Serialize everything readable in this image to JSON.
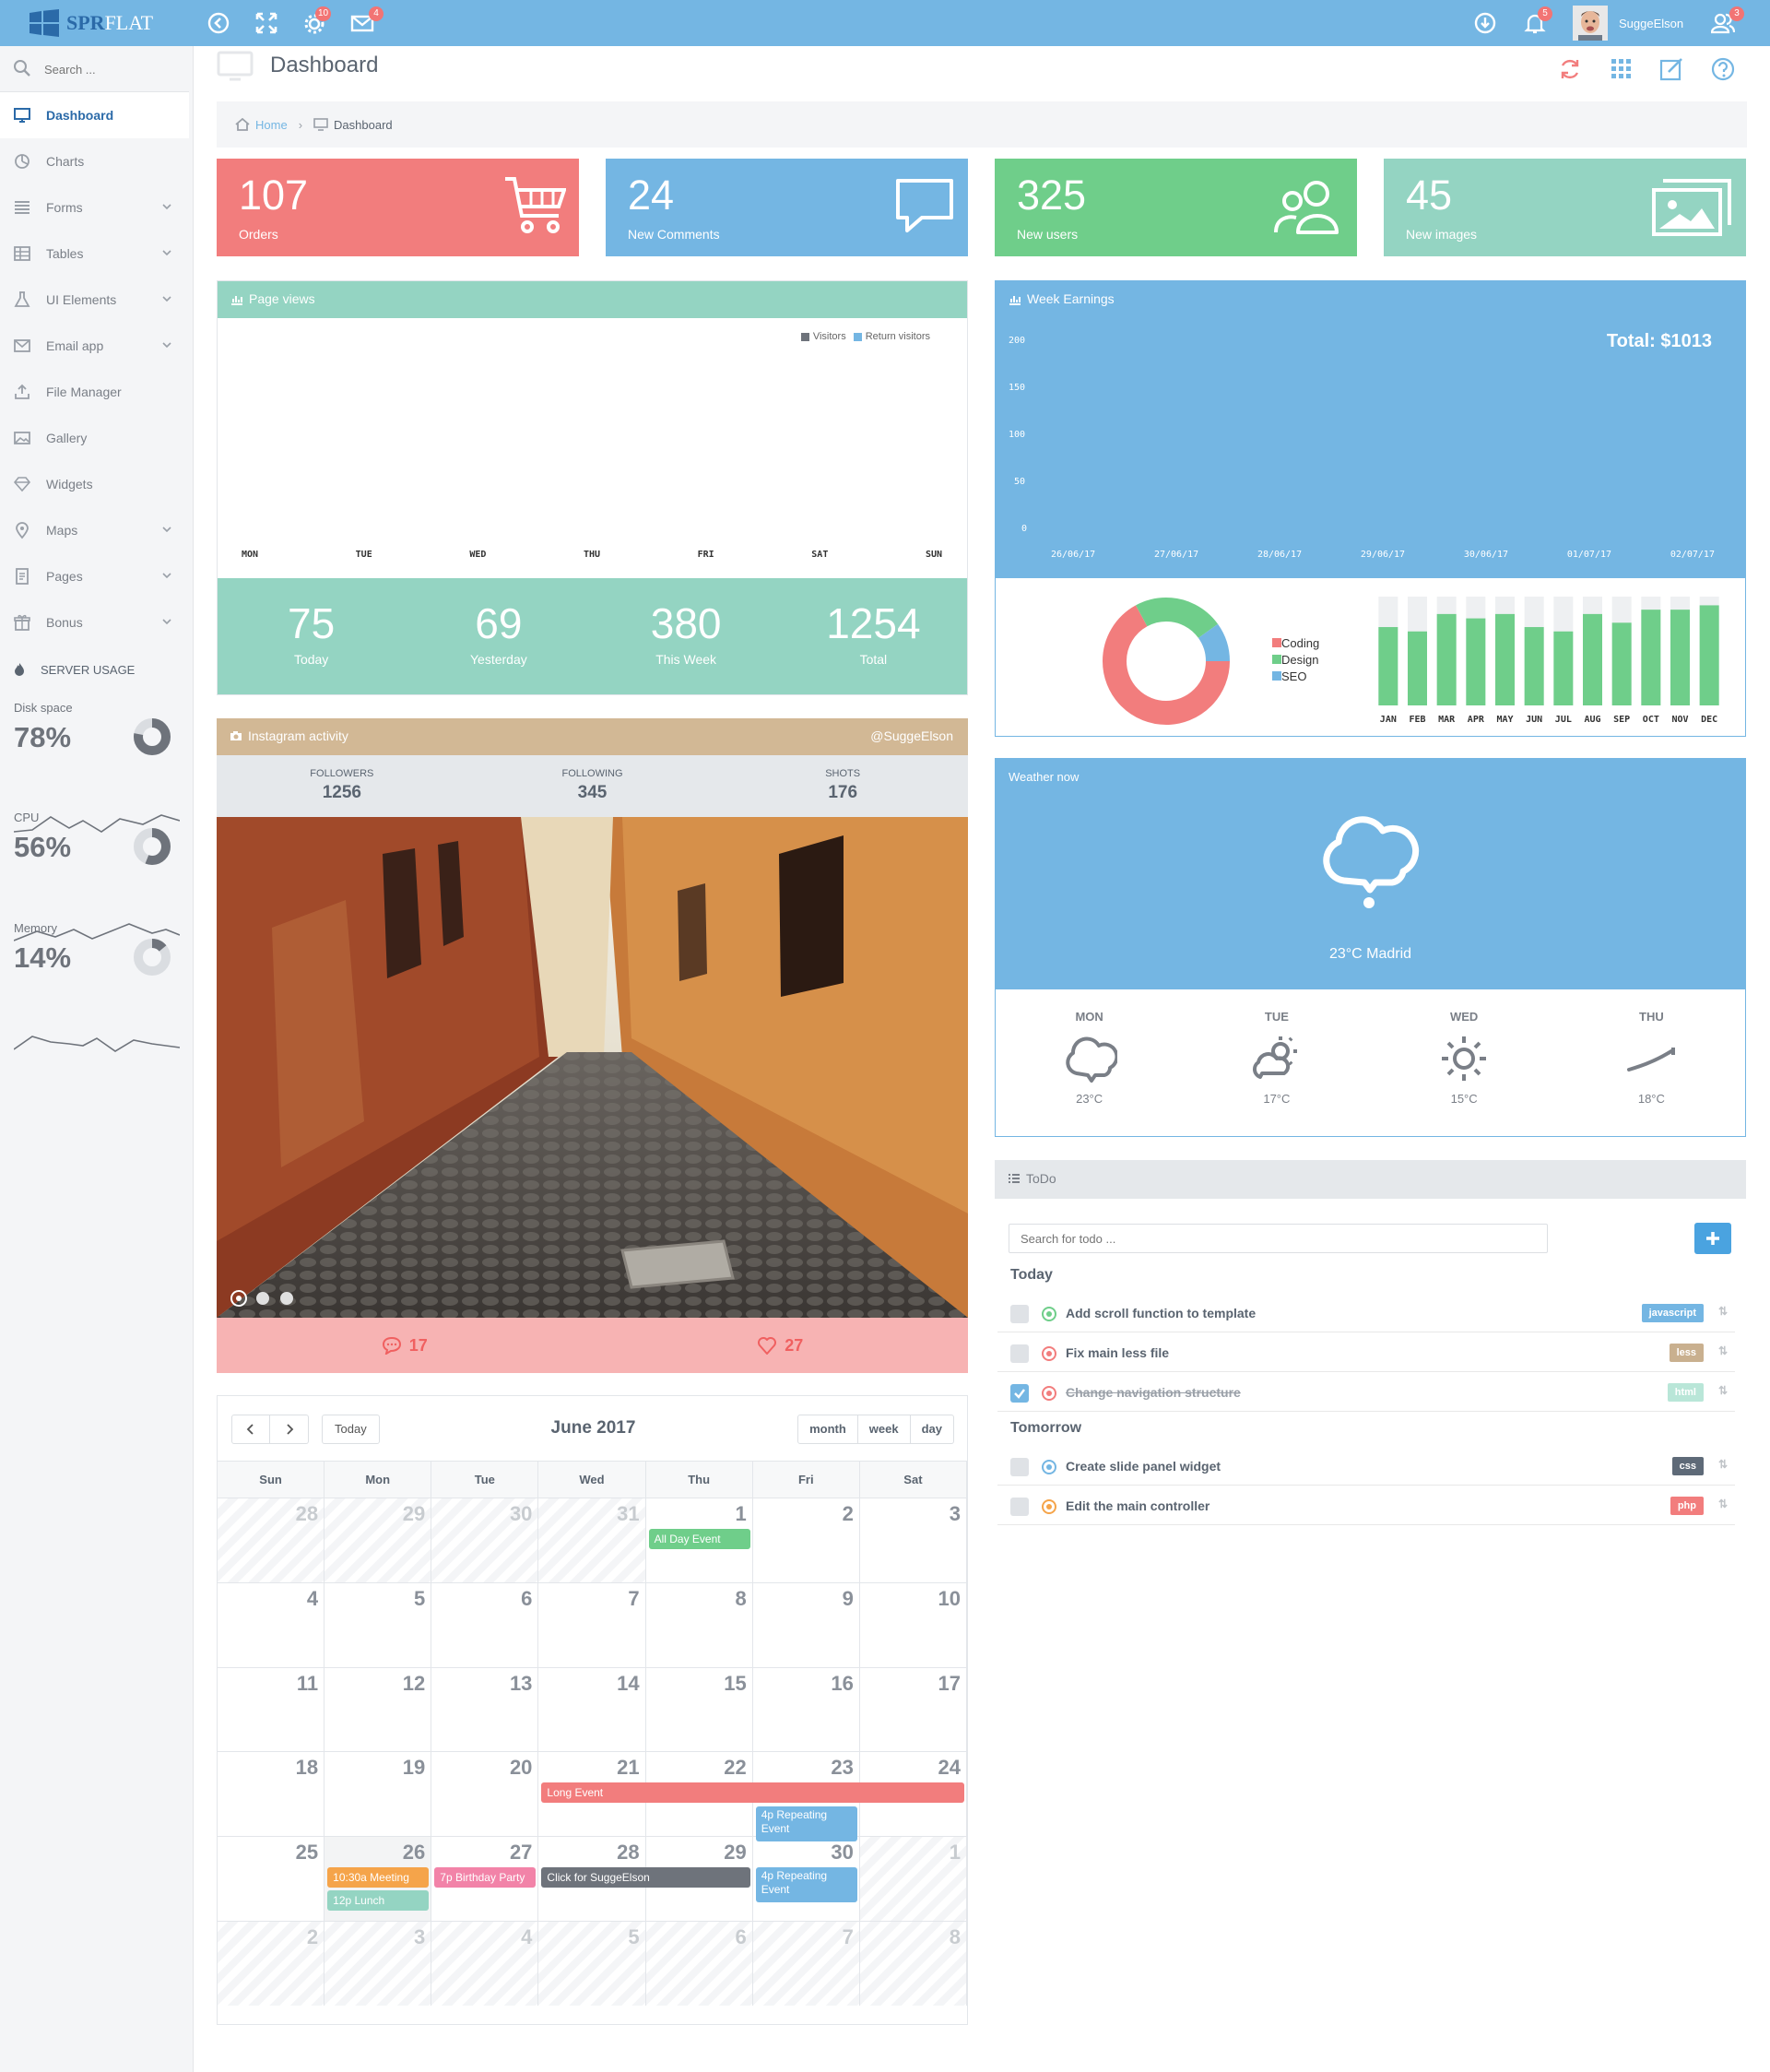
{
  "topbar": {
    "brand_bold": "SPR",
    "brand_light": "FLAT",
    "settings_badge": "10",
    "mail_badge": "4",
    "bell_badge": "5",
    "users_badge": "3",
    "username": "SuggeElson"
  },
  "sidebar": {
    "search_placeholder": "Search ...",
    "items": [
      {
        "label": "Dashboard",
        "icon": "monitor-icon"
      },
      {
        "label": "Charts",
        "icon": "chart-icon"
      },
      {
        "label": "Forms",
        "icon": "list-icon"
      },
      {
        "label": "Tables",
        "icon": "table-icon"
      },
      {
        "label": "UI Elements",
        "icon": "flask-icon"
      },
      {
        "label": "Email app",
        "icon": "envelope-icon"
      },
      {
        "label": "File Manager",
        "icon": "upload-icon"
      },
      {
        "label": "Gallery",
        "icon": "image-icon"
      },
      {
        "label": "Widgets",
        "icon": "diamond-icon"
      },
      {
        "label": "Maps",
        "icon": "pin-icon"
      },
      {
        "label": "Pages",
        "icon": "page-icon"
      },
      {
        "label": "Bonus",
        "icon": "gift-icon"
      }
    ],
    "server_usage_title": "SERVER USAGE",
    "stats": [
      {
        "label": "Disk space",
        "value": "78%",
        "percent": 78
      },
      {
        "label": "CPU",
        "value": "56%",
        "percent": 56
      },
      {
        "label": "Memory",
        "value": "14%",
        "percent": 14
      }
    ]
  },
  "page": {
    "title": "Dashboard",
    "breadcrumb_home": "Home",
    "breadcrumb_current": "Dashboard"
  },
  "tiles": [
    {
      "number": "107",
      "label": "Orders",
      "color": "#f27d7d",
      "icon": "cart-icon"
    },
    {
      "number": "24",
      "label": "New Comments",
      "color": "#74b6e3",
      "icon": "comment-icon"
    },
    {
      "number": "325",
      "label": "New users",
      "color": "#6fce8a",
      "icon": "users-icon"
    },
    {
      "number": "45",
      "label": "New images",
      "color": "#94d4c2",
      "icon": "images-icon"
    }
  ],
  "pageviews": {
    "title": "Page views",
    "legend": [
      "Visitors",
      "Return visitors"
    ],
    "days": [
      "MON",
      "TUE",
      "WED",
      "THU",
      "FRI",
      "SAT",
      "SUN"
    ],
    "stats": [
      {
        "value": "75",
        "label": "Today"
      },
      {
        "value": "69",
        "label": "Yesterday"
      },
      {
        "value": "380",
        "label": "This Week"
      },
      {
        "value": "1254",
        "label": "Total"
      }
    ]
  },
  "earnings": {
    "title": "Week Earnings",
    "total": "Total: $1013",
    "yticks": [
      "200",
      "150",
      "100",
      "50",
      "0"
    ],
    "dates": [
      "26/06/17",
      "27/06/17",
      "28/06/17",
      "29/06/17",
      "30/06/17",
      "01/07/17",
      "02/07/17"
    ]
  },
  "chart_data": [
    {
      "type": "pie",
      "categories": [
        "Coding",
        "Design",
        "SEO"
      ],
      "values": [
        67,
        23,
        10
      ],
      "colors": [
        "#f27d7d",
        "#6fce8a",
        "#74b6e3"
      ],
      "legend_position": "right"
    },
    {
      "type": "bar",
      "categories": [
        "JAN",
        "FEB",
        "MAR",
        "APR",
        "MAY",
        "JUN",
        "JUL",
        "AUG",
        "SEP",
        "OCT",
        "NOV",
        "DEC"
      ],
      "series": [
        {
          "values": [
            72,
            68,
            84,
            80,
            84,
            72,
            68,
            84,
            76,
            88,
            88,
            92
          ]
        }
      ],
      "ylim": [
        0,
        100
      ]
    }
  ],
  "instagram": {
    "title": "Instagram activity",
    "handle": "@SuggeElson",
    "followers_label": "FOLLOWERS",
    "followers": "1256",
    "following_label": "FOLLOWING",
    "following": "345",
    "shots_label": "SHOTS",
    "shots": "176",
    "comments": "17",
    "likes": "27"
  },
  "weather": {
    "title": "Weather now",
    "current": "23°C Madrid",
    "days": [
      {
        "day": "MON",
        "temp": "23°C",
        "icon": "cloud-icon"
      },
      {
        "day": "TUE",
        "temp": "17°C",
        "icon": "sun-cloud-icon"
      },
      {
        "day": "WED",
        "temp": "15°C",
        "icon": "sun-icon"
      },
      {
        "day": "THU",
        "temp": "18°C",
        "icon": "wind-icon"
      }
    ]
  },
  "todo": {
    "title": "ToDo",
    "search_placeholder": "Search for todo ...",
    "today_label": "Today",
    "tomorrow_label": "Tomorrow",
    "today": [
      {
        "text": "Add scroll function to template",
        "tag": "javascript",
        "tag_color": "#74b6e3",
        "status_color": "#6fce8a",
        "done": false
      },
      {
        "text": "Fix main less file",
        "tag": "less",
        "tag_color": "#c9b08f",
        "status_color": "#f27d7d",
        "done": false
      },
      {
        "text": "Change navigation structure",
        "tag": "html",
        "tag_color": "#b9e6d8",
        "status_color": "#f27d7d",
        "done": true
      }
    ],
    "tomorrow": [
      {
        "text": "Create slide panel widget",
        "tag": "css",
        "tag_color": "#5e6a78",
        "status_color": "#74b6e3",
        "done": false
      },
      {
        "text": "Edit the main controller",
        "tag": "php",
        "tag_color": "#f27d7d",
        "status_color": "#f5a44a",
        "done": false
      }
    ]
  },
  "calendar": {
    "title": "June 2017",
    "today_btn": "Today",
    "views": [
      "month",
      "week",
      "day"
    ],
    "weekdays": [
      "Sun",
      "Mon",
      "Tue",
      "Wed",
      "Thu",
      "Fri",
      "Sat"
    ],
    "weeks": [
      [
        "28",
        "29",
        "30",
        "31",
        "1",
        "2",
        "3"
      ],
      [
        "4",
        "5",
        "6",
        "7",
        "8",
        "9",
        "10"
      ],
      [
        "11",
        "12",
        "13",
        "14",
        "15",
        "16",
        "17"
      ],
      [
        "18",
        "19",
        "20",
        "21",
        "22",
        "23",
        "24"
      ],
      [
        "25",
        "26",
        "27",
        "28",
        "29",
        "30",
        "1"
      ],
      [
        "2",
        "3",
        "4",
        "5",
        "6",
        "7",
        "8"
      ]
    ],
    "events": {
      "all_day": "All Day Event",
      "long": "Long Event",
      "repeat1": "4p Repeating Event",
      "meeting": "10:30a Meeting",
      "lunch": "12p Lunch",
      "birthday": "7p Birthday Party",
      "click": "Click for SuggeElson",
      "repeat2": "4p Repeating Event"
    }
  }
}
